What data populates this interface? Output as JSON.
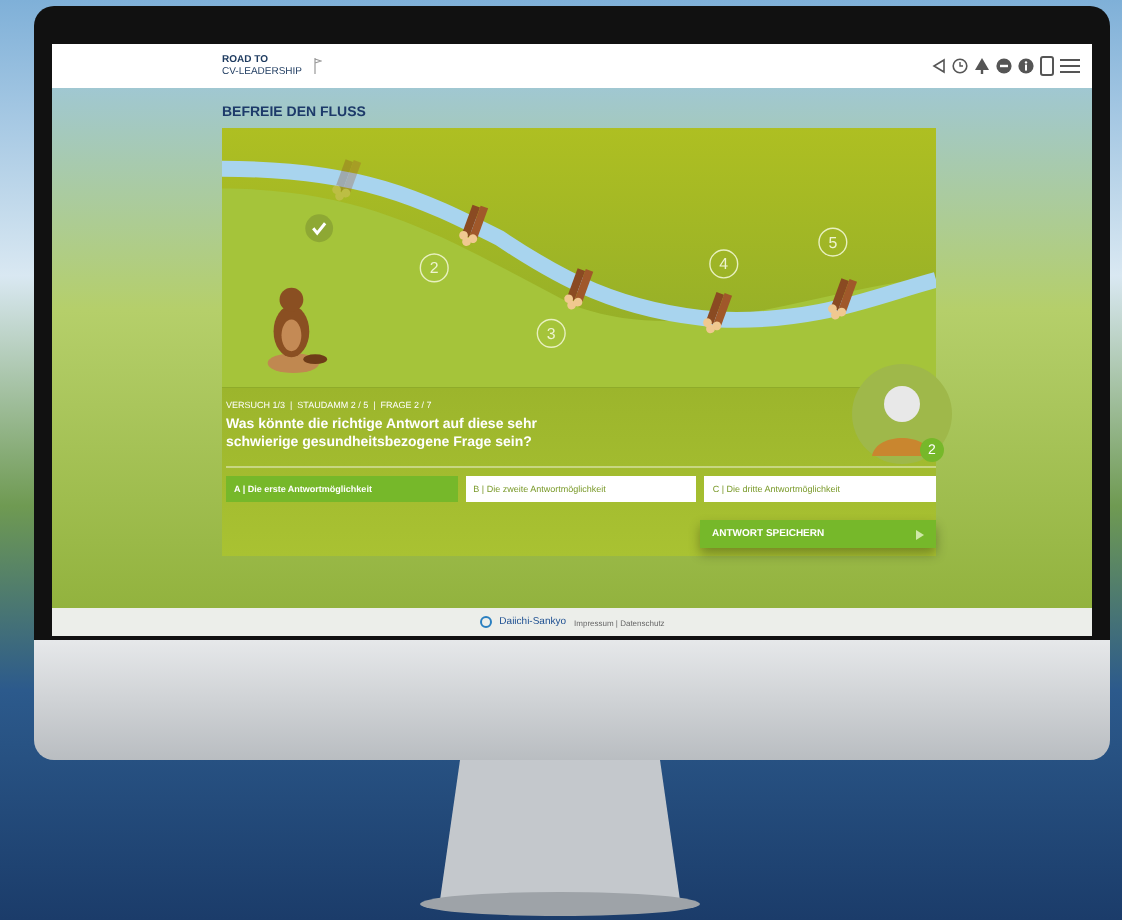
{
  "header": {
    "logo_line1": "ROAD TO",
    "logo_line2": "CV-LEADERSHIP"
  },
  "title": "BEFREIE DEN FLUSS",
  "stages": [
    {
      "done": true
    },
    {
      "number": "2",
      "done": false
    },
    {
      "number": "3",
      "done": false
    },
    {
      "number": "4",
      "done": false
    },
    {
      "number": "5",
      "done": false
    }
  ],
  "progress": "VERSUCH 1/3  |  STAUDAMM 2 / 5  |  FRAGE 2 / 7",
  "question": "Was könnte die richtige Antwort auf diese sehr schwierige gesundheitsbezogene Frage sein?",
  "avatar_badge": "2",
  "answers": [
    {
      "label": "A | Die erste Antwortmöglichkeit",
      "selected": true
    },
    {
      "label": "B | Die zweite Antwortmöglichkeit",
      "selected": false
    },
    {
      "label": "C | Die dritte Antwortmöglichkeit",
      "selected": false
    }
  ],
  "submit": "ANTWORT SPEICHERN",
  "footer": {
    "brand": "Daiichi-Sankyo",
    "links": "Impressum | Datenschutz"
  }
}
